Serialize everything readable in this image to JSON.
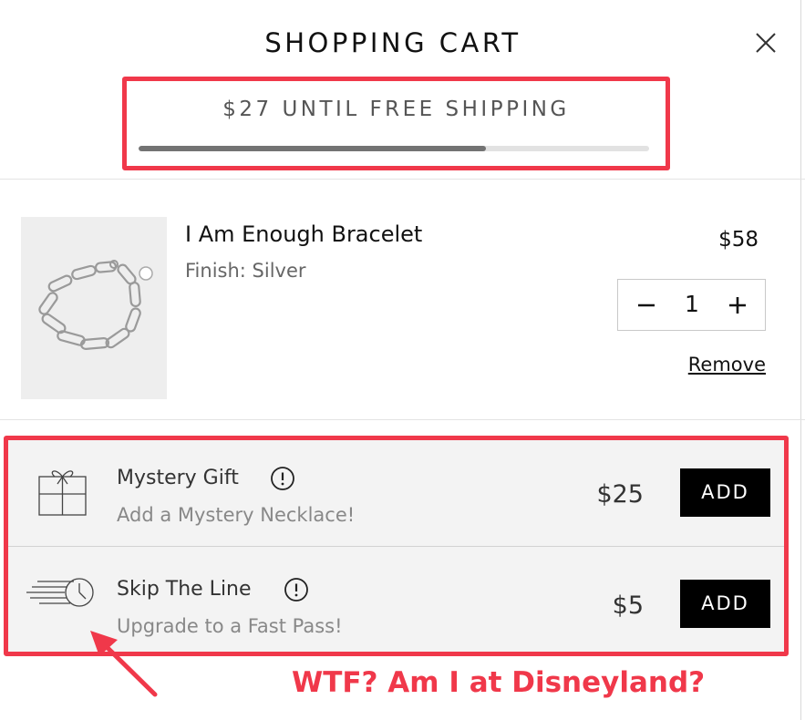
{
  "header": {
    "title": "SHOPPING CART",
    "close_icon": "close-icon"
  },
  "shipping": {
    "message": "$27 UNTIL FREE SHIPPING",
    "progress": 0.68
  },
  "cart_items": [
    {
      "name": "I Am Enough Bracelet",
      "finish": "Finish: Silver",
      "price": "$58",
      "quantity": "1",
      "remove_label": "Remove",
      "image": "silver-paperclip-chain-bracelet"
    }
  ],
  "upsells": [
    {
      "title": "Mystery Gift",
      "subtitle": "Add a Mystery Necklace!",
      "price": "$25",
      "button_label": "ADD",
      "icon": "gift-box-icon"
    },
    {
      "title": "Skip The Line",
      "subtitle": "Upgrade to a Fast Pass!",
      "price": "$5",
      "button_label": "ADD",
      "icon": "fast-clock-icon"
    }
  ],
  "annotation": {
    "text": "WTF? Am I at Disneyland?"
  },
  "colors": {
    "highlight_red": "#f0384a",
    "progress_fill": "#737373",
    "button_black": "#000000",
    "upsell_bg": "#f3f3f3"
  }
}
